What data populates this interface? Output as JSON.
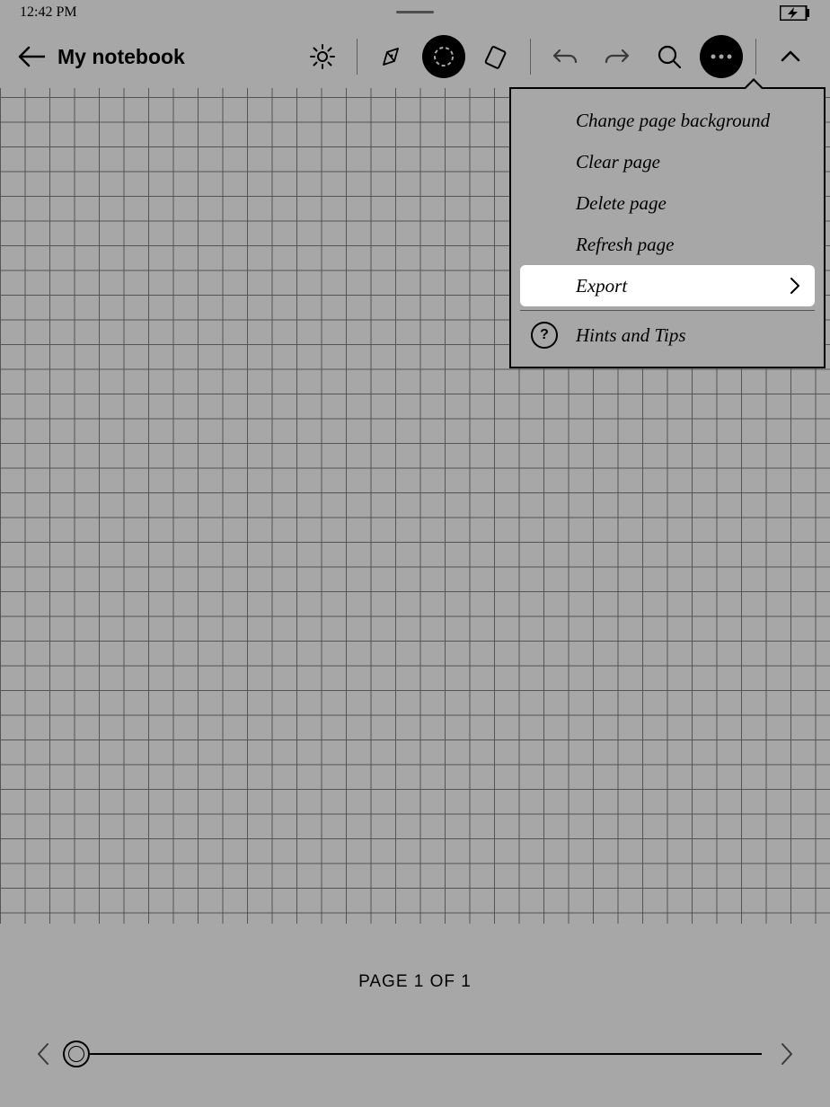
{
  "status": {
    "time": "12:42 PM"
  },
  "header": {
    "title": "My notebook"
  },
  "menu": {
    "items": [
      "Change page background",
      "Clear page",
      "Delete page",
      "Refresh page",
      "Export",
      "Hints and Tips"
    ]
  },
  "footer": {
    "page_label": "PAGE 1 OF 1"
  }
}
